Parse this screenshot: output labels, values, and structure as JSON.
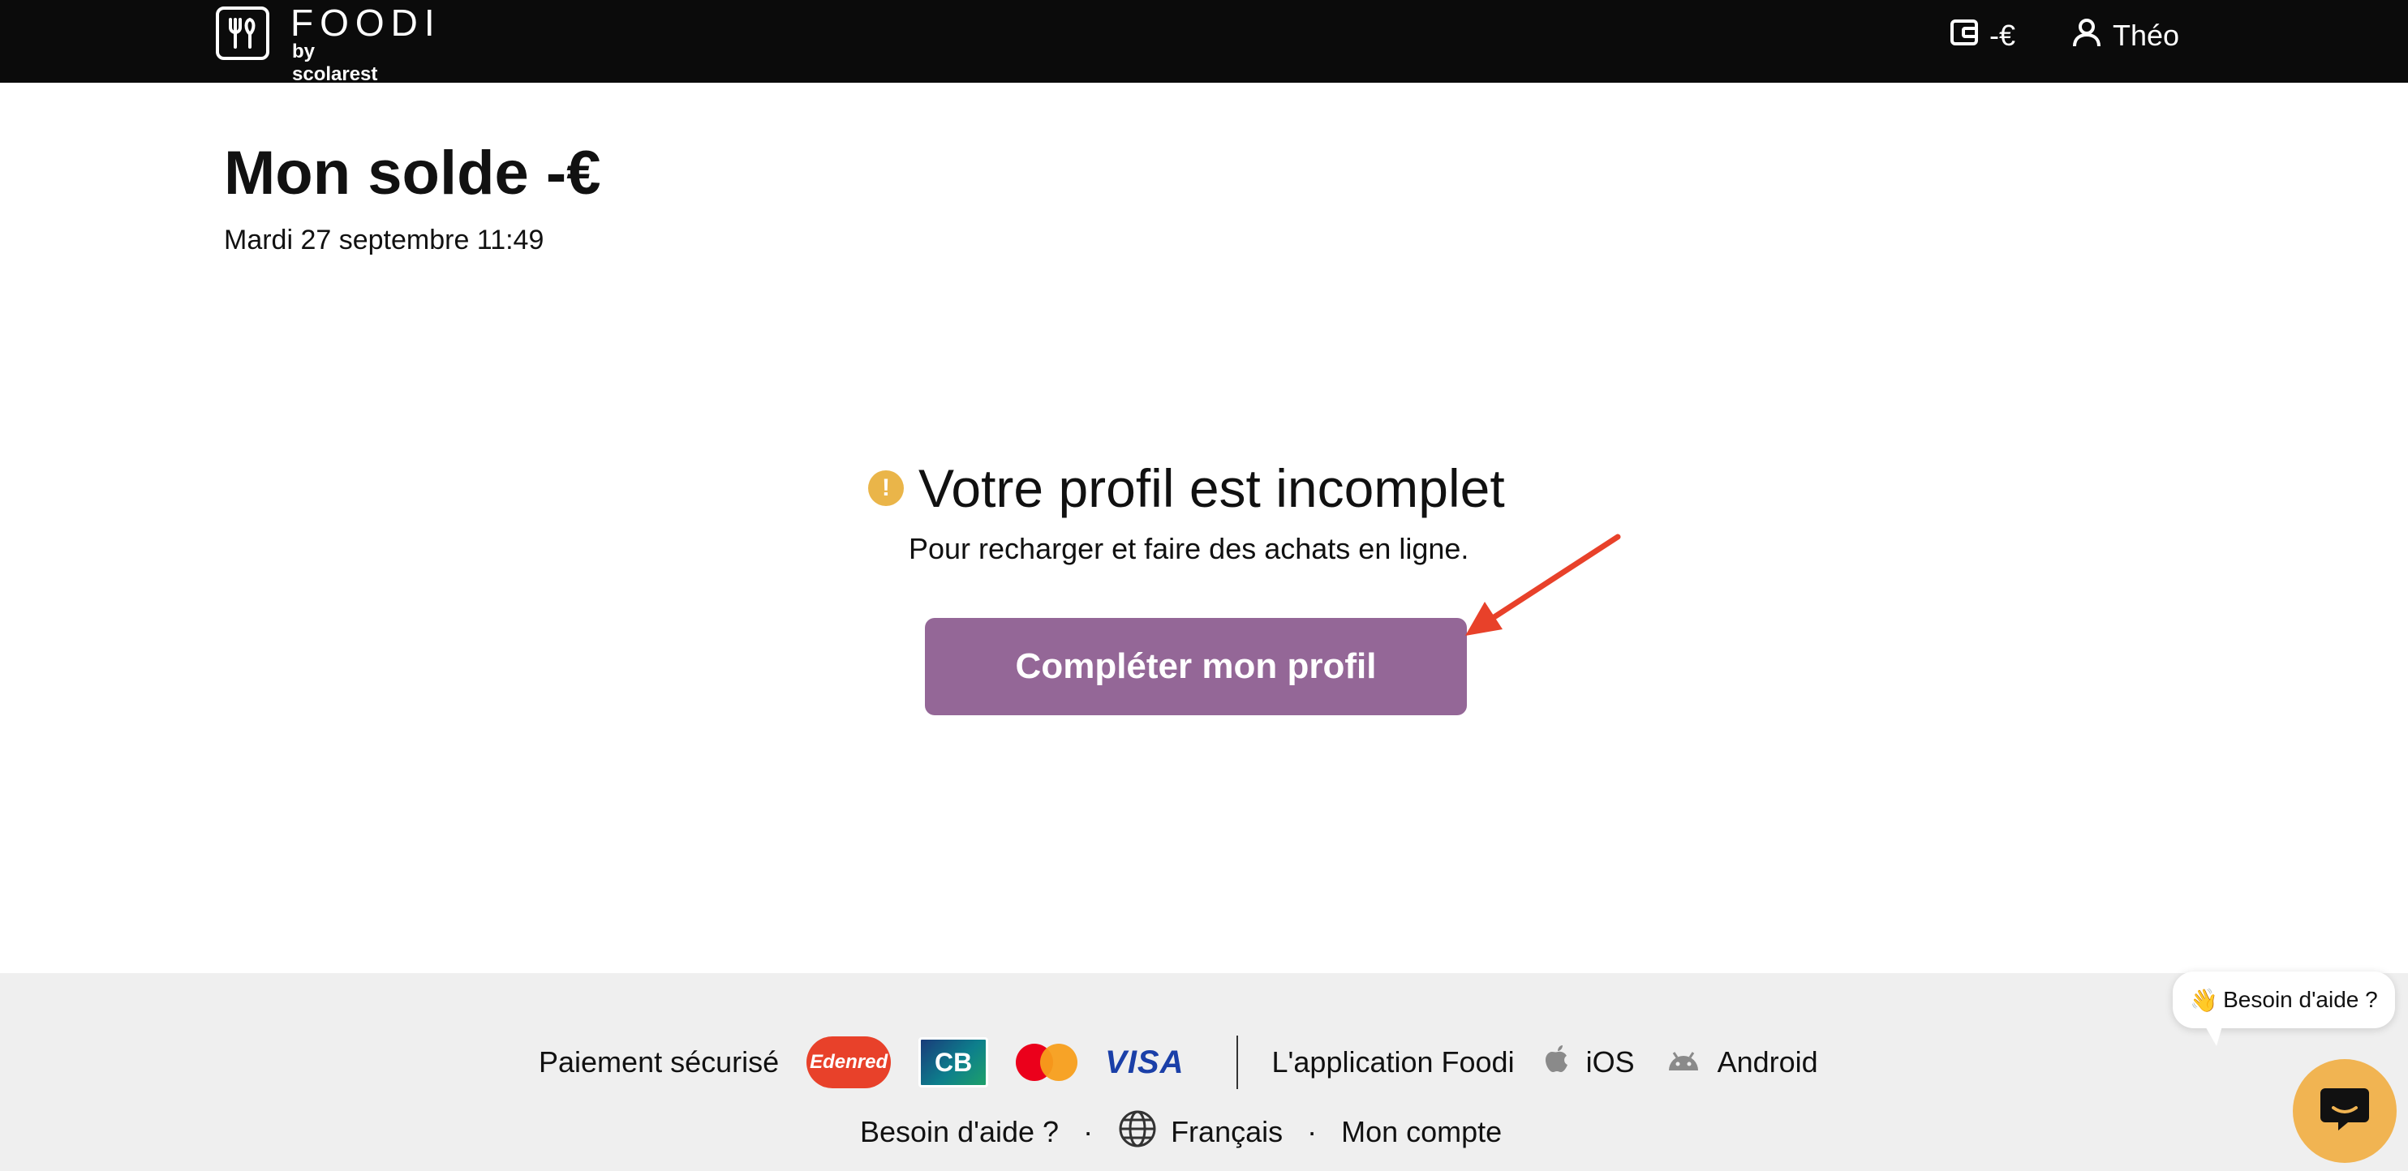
{
  "header": {
    "logo_name": "FOODI",
    "logo_sub": "by scolarest",
    "balance": "-€",
    "user_name": "Théo"
  },
  "main": {
    "title": "Mon solde -€",
    "datetime": "Mardi 27 septembre 11:49",
    "notice_title": "Votre profil est incomplet",
    "notice_icon_text": "!",
    "notice_subtitle": "Pour recharger et faire des achats en ligne.",
    "cta_label": "Compléter mon profil"
  },
  "footer": {
    "payment_label": "Paiement sécurisé",
    "payment_logos": {
      "edenred": "Edenred",
      "cb": "CB",
      "visa": "VISA"
    },
    "app_label": "L'application Foodi",
    "ios_label": "iOS",
    "android_label": "Android",
    "help_link": "Besoin d'aide ?",
    "separator": "·",
    "language": "Français",
    "account_link": "Mon compte"
  },
  "help_widget": {
    "emoji": "👋",
    "label": "Besoin d'aide ?"
  },
  "colors": {
    "topbar": "#0b0b0b",
    "cta": "#946797",
    "warning": "#eab549",
    "annotation_arrow": "#e8412a",
    "chat_button": "#f1b452",
    "footer": "#efefef"
  }
}
